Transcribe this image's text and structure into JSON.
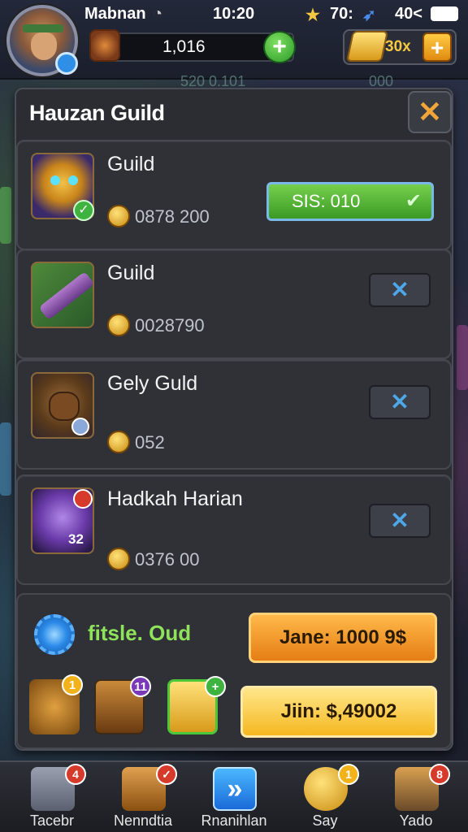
{
  "status": {
    "player_name": "Mabnan",
    "time": "10:20",
    "stars": "70:",
    "battery": "40<"
  },
  "resources": {
    "value": "1,016",
    "plus": "+"
  },
  "gold": {
    "multiplier": "30x",
    "plus": "+"
  },
  "background": {
    "text_1": "520 0.101",
    "text_2": "000"
  },
  "panel": {
    "title": "Hauzan Guild",
    "close": "✕"
  },
  "guilds": [
    {
      "name": "Guild",
      "value": "0878 200",
      "button": "SIS: 010"
    },
    {
      "name": "Guild",
      "value": "0028790",
      "button": "✕"
    },
    {
      "name": "Gely Guld",
      "value": "052",
      "button": "✕"
    },
    {
      "name": "Hadkah Harian",
      "value": "0376 00",
      "button": "✕",
      "level": "32"
    }
  ],
  "footer": {
    "label": "fitsle. Oud",
    "join_button": "Jane: 1000 9$",
    "buy_button": "Jiin: $,49002",
    "items": [
      {
        "badge": "1"
      },
      {
        "badge": "11"
      },
      {
        "badge": "+"
      }
    ]
  },
  "nav": [
    {
      "label": "Tacebr",
      "badge": "4"
    },
    {
      "label": "Nenndtia",
      "badge": "✓"
    },
    {
      "label": "Rnanihlan"
    },
    {
      "label": "Say",
      "badge": "1"
    },
    {
      "label": "Yado",
      "badge": "8"
    }
  ],
  "colors": {
    "accent_green": "#3fb33f",
    "accent_orange": "#e57d14",
    "accent_blue": "#4ea7e8",
    "gold": "#f5c842"
  }
}
